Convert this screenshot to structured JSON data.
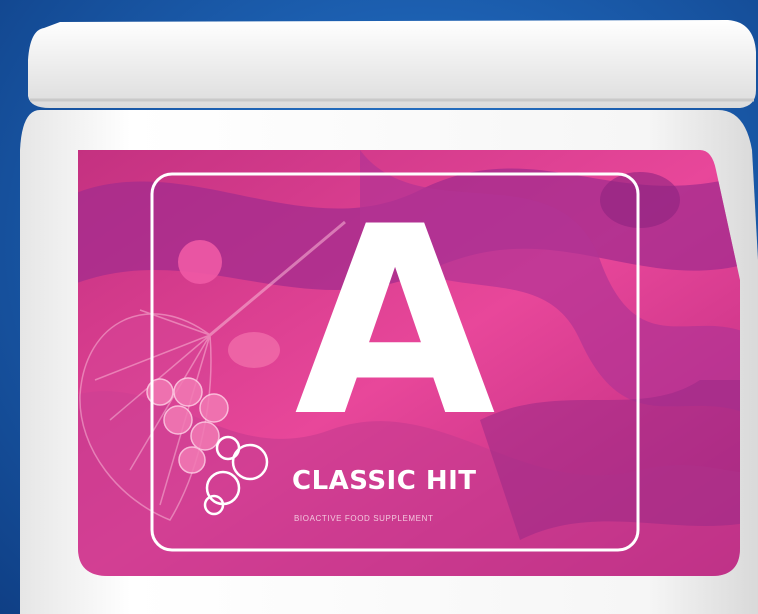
{
  "product": {
    "letter": "A",
    "name": "CLASSIC HIT",
    "subtitle": "BIOACTIVE FOOD SUPPLEMENT"
  },
  "colors": {
    "background": "#1c5fb0",
    "jar": "#f4f4f4",
    "label_pink": "#e5448f",
    "label_purple": "#9c2a8a",
    "text": "#ffffff"
  },
  "icons": [
    "ginkgo-leaf-icon",
    "berries-icon",
    "bubbles-logo-icon"
  ]
}
